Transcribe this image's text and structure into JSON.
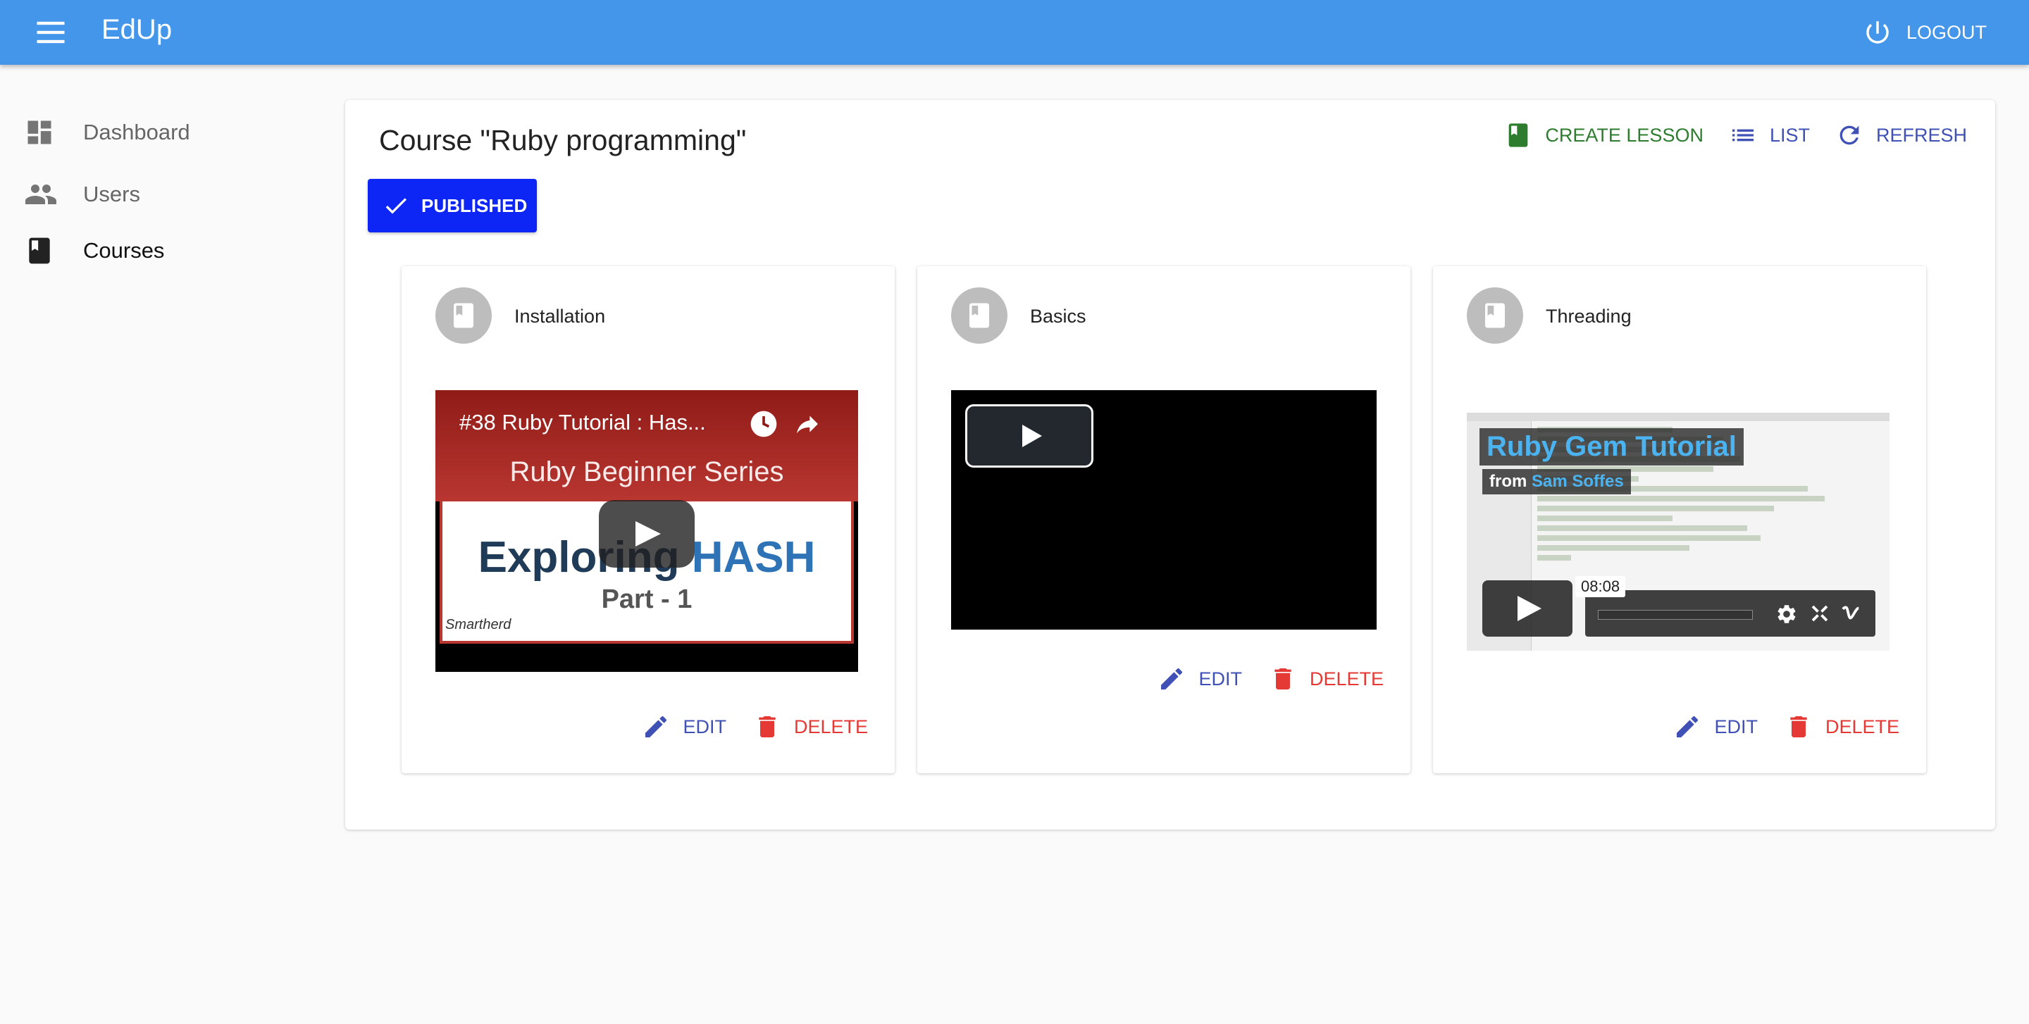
{
  "app": {
    "title": "EdUp",
    "logout_label": "LOGOUT"
  },
  "sidebar": {
    "items": [
      {
        "label": "Dashboard",
        "icon": "dashboard-icon",
        "active": false
      },
      {
        "label": "Users",
        "icon": "people-icon",
        "active": false
      },
      {
        "label": "Courses",
        "icon": "book-icon",
        "active": true
      }
    ]
  },
  "course": {
    "title": "Course \"Ruby programming\"",
    "status_label": "PUBLISHED",
    "actions": {
      "create_lesson": "CREATE LESSON",
      "list": "LIST",
      "refresh": "REFRESH"
    }
  },
  "lessons": [
    {
      "title": "Installation",
      "video": {
        "provider": "youtube",
        "title": "#38 Ruby Tutorial : Has...",
        "series": "Ruby Beginner Series",
        "headline_a": "Exploring ",
        "headline_b": "HASH",
        "part": "Part - 1",
        "brand": "Smartherd"
      },
      "edit_label": "EDIT",
      "delete_label": "DELETE"
    },
    {
      "title": "Basics",
      "video": {
        "provider": "generic"
      },
      "edit_label": "EDIT",
      "delete_label": "DELETE"
    },
    {
      "title": "Threading",
      "video": {
        "provider": "vimeo",
        "title": "Ruby Gem Tutorial",
        "from_prefix": "from ",
        "author": "Sam Soffes",
        "duration": "08:08"
      },
      "edit_label": "EDIT",
      "delete_label": "DELETE"
    }
  ],
  "colors": {
    "appbar": "#4496ea",
    "published": "#0d26f5",
    "create_lesson": "#2e7d2e",
    "primary_action": "#3f51b5",
    "delete": "#e53935"
  }
}
